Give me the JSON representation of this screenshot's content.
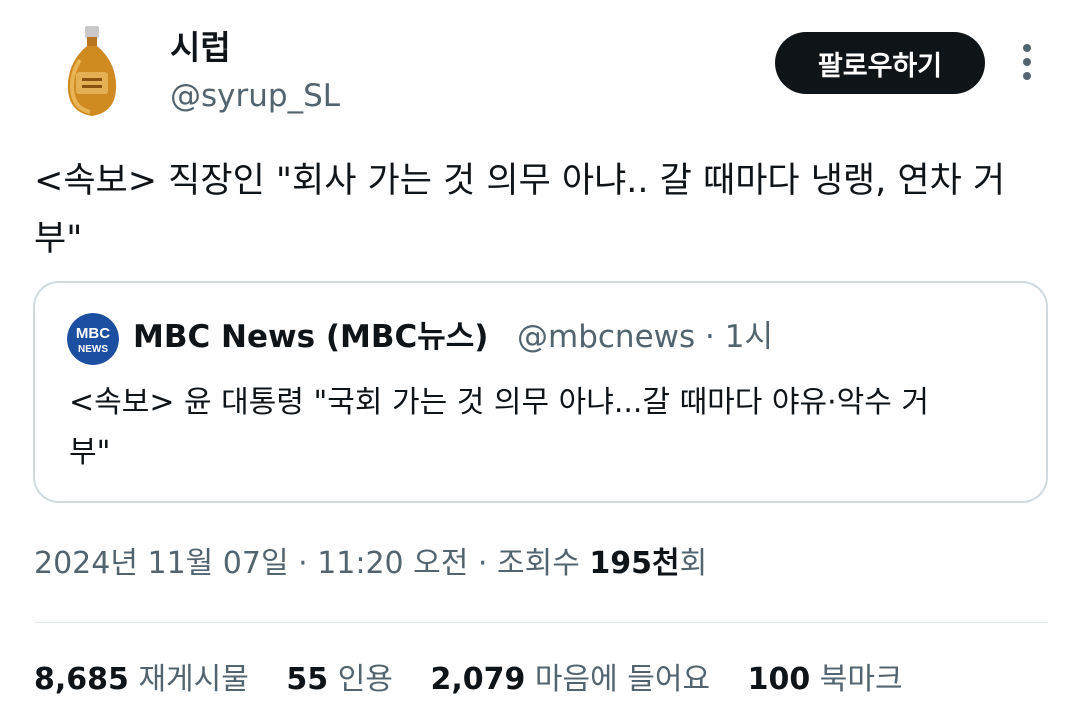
{
  "author": {
    "display_name": "시럽",
    "handle": "@syrup_SL",
    "avatar_icon": "syrup-bottle-icon"
  },
  "header": {
    "follow_label": "팔로우하기",
    "more_icon": "more-vertical-icon"
  },
  "tweet": {
    "text": "<속보> 직장인 \"회사 가는 것 의무 아냐.. 갈 때마다 냉랭, 연차 거부\""
  },
  "quote": {
    "logo_text_top": "MBC",
    "logo_text_bottom": "NEWS",
    "name": "MBC News (MBC뉴스)",
    "handle": "@mbcnews",
    "separator": " · ",
    "time": "1시",
    "text": "<속보> 윤 대통령 \"국회 가는 것 의무 아냐...갈 때마다 야유·악수 거부\""
  },
  "meta": {
    "date": "2024년 11월 07일",
    "sep": " · ",
    "time": "11:20 오전",
    "views_label_prefix": "조회수 ",
    "views_num": "195천",
    "views_label_suffix": "회"
  },
  "stats": [
    {
      "num": "8,685",
      "label": "재게시물"
    },
    {
      "num": "55",
      "label": "인용"
    },
    {
      "num": "2,079",
      "label": "마음에 들어요"
    },
    {
      "num": "100",
      "label": "북마크"
    }
  ],
  "colors": {
    "text": "#0f1419",
    "muted": "#536471",
    "border": "#cfd9de",
    "mbc_blue": "#1d4fa0"
  }
}
